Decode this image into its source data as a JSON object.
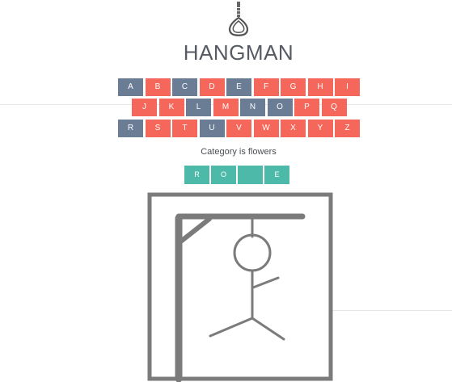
{
  "game": {
    "title": "HANGMAN",
    "category_text": "Category is flowers"
  },
  "keyboard": {
    "rows": [
      [
        {
          "letter": "A",
          "used": true
        },
        {
          "letter": "B",
          "used": false
        },
        {
          "letter": "C",
          "used": true
        },
        {
          "letter": "D",
          "used": false
        },
        {
          "letter": "E",
          "used": true
        },
        {
          "letter": "F",
          "used": false
        },
        {
          "letter": "G",
          "used": false
        },
        {
          "letter": "H",
          "used": false
        },
        {
          "letter": "I",
          "used": false
        }
      ],
      [
        {
          "letter": "J",
          "used": false
        },
        {
          "letter": "K",
          "used": false
        },
        {
          "letter": "L",
          "used": true
        },
        {
          "letter": "M",
          "used": false
        },
        {
          "letter": "N",
          "used": true
        },
        {
          "letter": "O",
          "used": true
        },
        {
          "letter": "P",
          "used": false
        },
        {
          "letter": "Q",
          "used": false
        }
      ],
      [
        {
          "letter": "R",
          "used": true
        },
        {
          "letter": "S",
          "used": false
        },
        {
          "letter": "T",
          "used": false
        },
        {
          "letter": "U",
          "used": true
        },
        {
          "letter": "V",
          "used": false
        },
        {
          "letter": "W",
          "used": false
        },
        {
          "letter": "X",
          "used": false
        },
        {
          "letter": "Y",
          "used": false
        },
        {
          "letter": "Z",
          "used": false
        }
      ]
    ]
  },
  "word": {
    "tiles": [
      "R",
      "O",
      "",
      "E"
    ]
  },
  "colors": {
    "used_key": "#6b7d94",
    "unused_key": "#f4675a",
    "tile": "#4dbaa9",
    "gallows": "#7b7b7b"
  },
  "icons": {
    "logo": "noose-icon"
  }
}
